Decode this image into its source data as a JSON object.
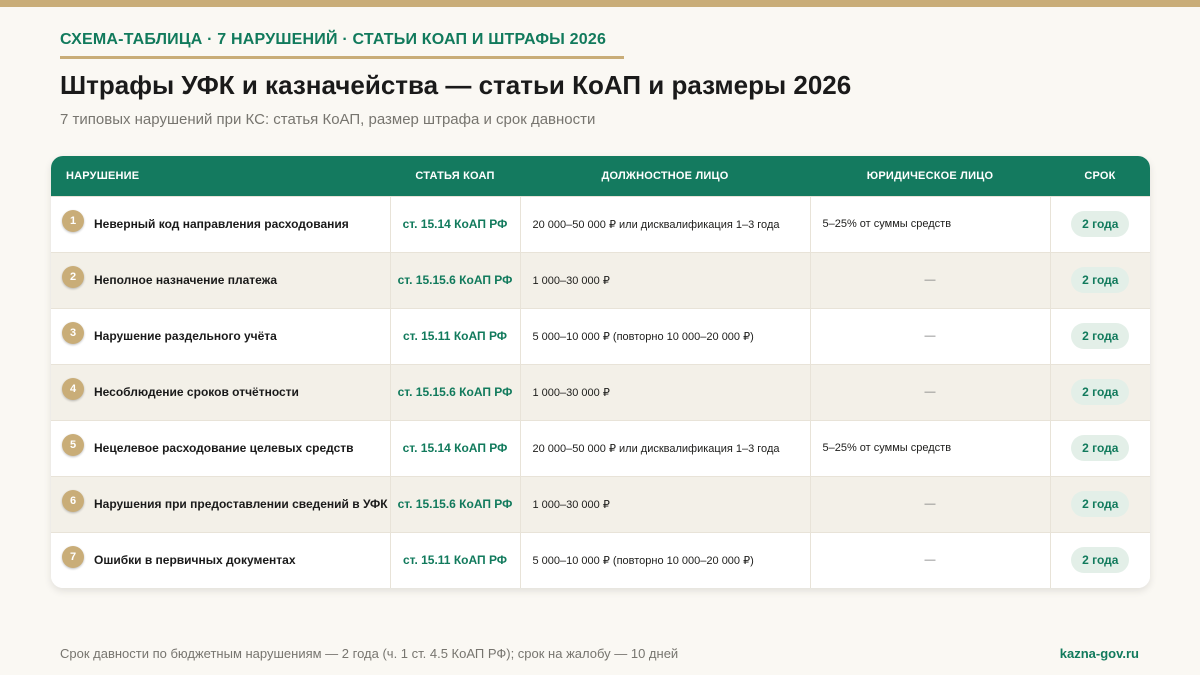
{
  "header": {
    "kicker": "СХЕМА-ТАБЛИЦА · 7 НАРУШЕНИЙ · СТАТЬИ КОАП И ШТРАФЫ 2026",
    "title": "Штрафы УФК и казначейства — статьи КоАП и размеры 2026",
    "subtitle": "7 типовых нарушений при КС: статья КоАП, размер штрафа и срок давности"
  },
  "table": {
    "columns": [
      "НАРУШЕНИЕ",
      "СТАТЬЯ КОАП",
      "ДОЛЖНОСТНОЕ ЛИЦО",
      "ЮРИДИЧЕСКОЕ ЛИЦО",
      "СРОК"
    ],
    "rows": [
      {
        "num": "1",
        "violation": "Неверный код направления расходования",
        "article": "ст. 15.14 КоАП РФ",
        "official": "20 000–50 000 ₽ или дисквалификация 1–3 года",
        "legal": "5–25% от суммы средств",
        "term": "2 года"
      },
      {
        "num": "2",
        "violation": "Неполное назначение платежа",
        "article": "ст. 15.15.6 КоАП РФ",
        "official": "1 000–30 000 ₽",
        "legal": "—",
        "term": "2 года"
      },
      {
        "num": "3",
        "violation": "Нарушение раздельного учёта",
        "article": "ст. 15.11 КоАП РФ",
        "official": "5 000–10 000 ₽ (повторно 10 000–20 000 ₽)",
        "legal": "—",
        "term": "2 года"
      },
      {
        "num": "4",
        "violation": "Несоблюдение сроков отчётности",
        "article": "ст. 15.15.6 КоАП РФ",
        "official": "1 000–30 000 ₽",
        "legal": "—",
        "term": "2 года"
      },
      {
        "num": "5",
        "violation": "Нецелевое расходование целевых средств",
        "article": "ст. 15.14 КоАП РФ",
        "official": "20 000–50 000 ₽ или дисквалификация 1–3 года",
        "legal": "5–25% от суммы средств",
        "term": "2 года"
      },
      {
        "num": "6",
        "violation": "Нарушения при предоставлении сведений в УФК",
        "article": "ст. 15.15.6 КоАП РФ",
        "official": "1 000–30 000 ₽",
        "legal": "—",
        "term": "2 года"
      },
      {
        "num": "7",
        "violation": "Ошибки в первичных документах",
        "article": "ст. 15.11 КоАП РФ",
        "official": "5 000–10 000 ₽ (повторно 10 000–20 000 ₽)",
        "legal": "—",
        "term": "2 года"
      }
    ]
  },
  "footer": {
    "note": "Срок давности по бюджетным нарушениям — 2 года (ч. 1 ст. 4.5 КоАП РФ); срок на жалобу — 10 дней",
    "site": "kazna-gov.ru"
  },
  "colors": {
    "accent_green": "#147a5f",
    "accent_gold": "#c9ad78",
    "background": "#faf8f3"
  }
}
